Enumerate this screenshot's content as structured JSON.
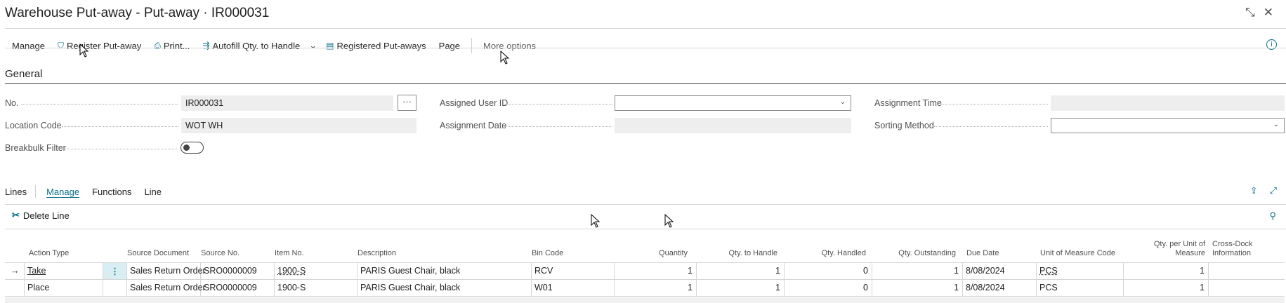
{
  "page": {
    "title": "Warehouse Put-away - Put-away · IR000031"
  },
  "title_actions": {
    "collapse_icon": "collapse-icon",
    "close_icon": "close-icon"
  },
  "actions": {
    "manage": "Manage",
    "register_putaway": "Register Put-away",
    "print": "Print...",
    "autofill": "Autofill Qty. to Handle",
    "registered_putaways": "Registered Put-aways",
    "page": "Page",
    "more_options": "More options"
  },
  "general": {
    "title": "General",
    "fields": {
      "no_label": "No.",
      "no_value": "IR000031",
      "lookup_label": "···",
      "location_label": "Location Code",
      "location_value": "WOT WH",
      "breakbulk_label": "Breakbulk Filter",
      "assigned_user_label": "Assigned User ID",
      "assigned_user_value": "",
      "assignment_date_label": "Assignment Date",
      "assignment_date_value": "",
      "assignment_time_label": "Assignment Time",
      "assignment_time_value": "",
      "sorting_method_label": "Sorting Method",
      "sorting_method_value": ""
    }
  },
  "lines": {
    "title": "Lines",
    "tabs": [
      "Manage",
      "Functions",
      "Line"
    ],
    "delete_line": "Delete Line",
    "columns": {
      "action_type": "Action Type",
      "source_document": "Source Document",
      "source_no": "Source No.",
      "item_no": "Item No.",
      "description": "Description",
      "bin_code": "Bin Code",
      "quantity": "Quantity",
      "qty_to_handle": "Qty. to Handle",
      "qty_handled": "Qty. Handled",
      "qty_outstanding": "Qty. Outstanding",
      "due_date": "Due Date",
      "uom_code": "Unit of Measure Code",
      "qty_per_uom_1": "Qty. per Unit of",
      "qty_per_uom_2": "Measure",
      "cross_dock_1": "Cross-Dock",
      "cross_dock_2": "Information"
    },
    "rows": [
      {
        "action_type": "Take",
        "source_document": "Sales Return Order",
        "source_no": "SRO0000009",
        "item_no": "1900-S",
        "description": "PARIS Guest Chair, black",
        "bin_code": "RCV",
        "quantity": "1",
        "qty_to_handle": "1",
        "qty_handled": "0",
        "qty_outstanding": "1",
        "due_date": "8/08/2024",
        "uom_code": "PCS",
        "qty_per_uom": "1",
        "cross_dock": ""
      },
      {
        "action_type": "Place",
        "source_document": "Sales Return Order",
        "source_no": "SRO0000009",
        "item_no": "1900-S",
        "description": "PARIS Guest Chair, black",
        "bin_code": "W01",
        "quantity": "1",
        "qty_to_handle": "1",
        "qty_handled": "0",
        "qty_outstanding": "1",
        "due_date": "8/08/2024",
        "uom_code": "PCS",
        "qty_per_uom": "1",
        "cross_dock": ""
      }
    ]
  },
  "colors": {
    "accent": "#0a6f89",
    "border": "#d6d6d6",
    "field_bg": "#eeeeee"
  }
}
